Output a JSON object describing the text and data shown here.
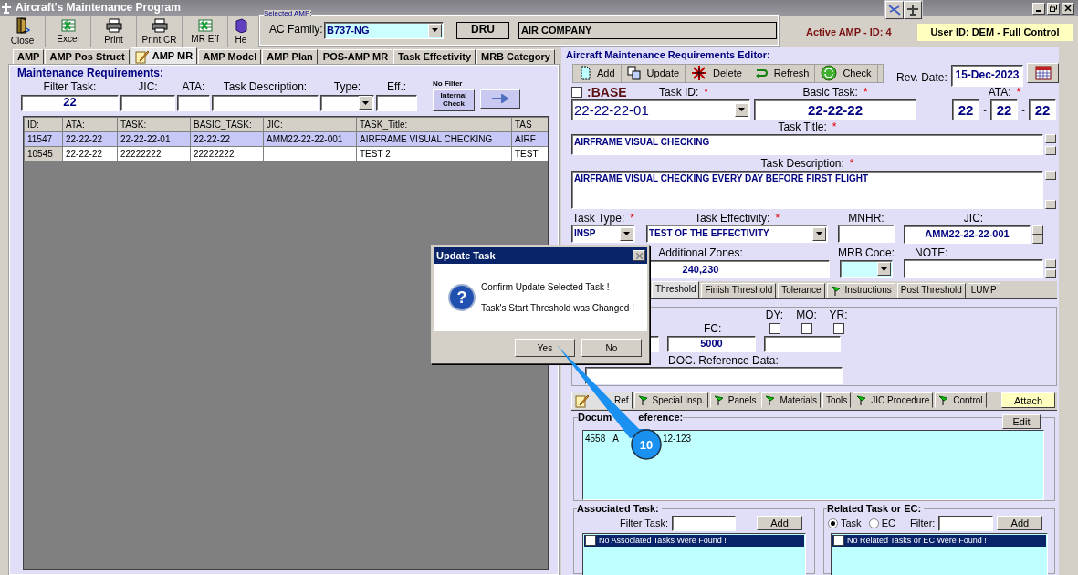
{
  "window": {
    "title": "Aircraft's Maintenance Program"
  },
  "toolbar": [
    {
      "label": "Close",
      "kind": "door"
    },
    {
      "label": "Excel",
      "kind": "sheet"
    },
    {
      "label": "Print",
      "kind": "printer"
    },
    {
      "label": "Print CR",
      "kind": "printer"
    },
    {
      "label": "MR Eff",
      "kind": "sheet"
    },
    {
      "label": "He",
      "kind": "help"
    }
  ],
  "selected_amp": {
    "legend": "Selected AMP:",
    "ac_family_label": "AC Family:",
    "ac_family": "B737-NG",
    "code": "DRU",
    "company": "AIR COMPANY"
  },
  "active_amp": "Active AMP - ID: 4",
  "user": "User ID: DEM - Full Control",
  "left_tabs": [
    {
      "label": "AMP",
      "selected": false,
      "kind": "plain"
    },
    {
      "label": "AMP Pos Struct",
      "selected": false,
      "kind": "plain"
    },
    {
      "label": "AMP MR",
      "selected": true,
      "kind": "note"
    },
    {
      "label": "AMP Model",
      "selected": false,
      "kind": "plain"
    },
    {
      "label": "AMP Plan",
      "selected": false,
      "kind": "plain"
    },
    {
      "label": "POS-AMP MR",
      "selected": false,
      "kind": "plain"
    },
    {
      "label": "Task Effectivity",
      "selected": false,
      "kind": "plain"
    },
    {
      "label": "MRB Category",
      "selected": false,
      "kind": "plain"
    }
  ],
  "requirements": {
    "legend": "Maintenance Requirements:",
    "filters": [
      {
        "label": "Filter Task:",
        "value": "22",
        "kind": "text"
      },
      {
        "label": "JIC:",
        "kind": "text"
      },
      {
        "label": "ATA:",
        "kind": "text"
      },
      {
        "label": "Task Description:",
        "kind": "text"
      },
      {
        "label": "Type:",
        "kind": "select"
      },
      {
        "label": "Eff.:",
        "kind": "text"
      }
    ],
    "no_filter": "No Filter",
    "internal_check": "Internal Check",
    "columns": [
      "ID:",
      "ATA:",
      "TASK:",
      "BASIC_TASK:",
      "JIC:",
      "TASK_Title:",
      "TAS"
    ],
    "rows": [
      {
        "selected": true,
        "cells": [
          "11547",
          "22-22-22",
          "22-22-22-01",
          "22-22-22",
          "AMM22-22-22-001",
          "AIRFRAME VISUAL CHECKING",
          "AIRF"
        ]
      },
      {
        "selected": false,
        "cells": [
          "10545",
          "22-22-22",
          "22222222",
          "22222222",
          null,
          "TEST 2",
          "TEST"
        ]
      }
    ]
  },
  "editor": {
    "legend": "Aircraft Maintenance Requirements Editor:",
    "toolbar": [
      {
        "label": "Add",
        "kind": "page"
      },
      {
        "label": "Update",
        "kind": "update"
      },
      {
        "label": "Delete",
        "kind": "delete"
      },
      {
        "label": "Refresh",
        "kind": "refresh"
      },
      {
        "label": "Check",
        "kind": "check"
      }
    ],
    "rev_date_label": "Rev. Date:",
    "rev_date": "15-Dec-2023",
    "base": {
      "label": ":BASE",
      "checked": false
    },
    "task_id": {
      "label": "Task ID:",
      "mark": "*",
      "value": "22-22-22-01"
    },
    "basic_task": {
      "label": "Basic Task:",
      "mark": "*",
      "value": "22-22-22"
    },
    "ata": {
      "label": "ATA:",
      "mark": "*",
      "parts": [
        "22",
        "22",
        "22"
      ],
      "separators": [
        "-",
        "-"
      ]
    },
    "task_title": {
      "label": "Task Title:",
      "mark": "*",
      "value": "AIRFRAME VISUAL CHECKING"
    },
    "task_description": {
      "label": "Task Description:",
      "mark": "*",
      "value": "AIRFRAME VISUAL CHECKING EVERY DAY BEFORE FIRST FLIGHT"
    },
    "task_type": {
      "label": "Task Type:",
      "mark": "*",
      "value": "INSP"
    },
    "task_effectivity": {
      "label": "Task Effectivity:",
      "mark": "*",
      "value": "TEST OF THE EFFECTIVITY"
    },
    "mnhr": {
      "label": "MNHR:"
    },
    "jic": {
      "label": "JIC:",
      "value": "AMM22-22-22-001"
    },
    "additional_zones": {
      "label": "Additional Zones:",
      "value": "240,230"
    },
    "mrb_code": {
      "label": "MRB Code:"
    },
    "note": {
      "label": "NOTE:"
    },
    "threshold_tabs": [
      {
        "label": "Threshold",
        "selected": true,
        "kind": "plain"
      },
      {
        "label": "Finish Threshold",
        "selected": false,
        "kind": "plain"
      },
      {
        "label": "Tolerance",
        "selected": false,
        "kind": "plain"
      },
      {
        "label": "Instructions",
        "selected": false,
        "kind": "flag"
      },
      {
        "label": "Post Threshold",
        "selected": false,
        "kind": "plain"
      },
      {
        "label": "LUMP",
        "selected": false,
        "kind": "plain"
      }
    ],
    "threshold": {
      "fc_label": "FC:",
      "fc": "5000",
      "periods": [
        {
          "label": "DY:",
          "checked": false
        },
        {
          "label": "MO:",
          "checked": false
        },
        {
          "label": "YR:",
          "checked": false
        }
      ],
      "doc_reference_label": "DOC. Reference Data:"
    },
    "doc_tabs": [
      {
        "label": "Ref",
        "selected": true,
        "kind": "note"
      },
      {
        "label": "Special Insp.",
        "selected": false,
        "kind": "flag"
      },
      {
        "label": "Panels",
        "selected": false,
        "kind": "flag"
      },
      {
        "label": "Materials",
        "selected": false,
        "kind": "flag"
      },
      {
        "label": "Tools",
        "selected": false,
        "kind": "plain"
      },
      {
        "label": "JIC Procedure",
        "selected": false,
        "kind": "flag"
      },
      {
        "label": "Control",
        "selected": false,
        "kind": "flag"
      }
    ],
    "attach": "Attach",
    "document_reference": {
      "legend": [
        "Docum",
        "eference:"
      ],
      "edit": "Edit",
      "text": [
        "4558",
        "A",
        "12-123"
      ]
    },
    "associated": {
      "legend": "Associated Task:",
      "filter_label": "Filter Task:",
      "add": "Add",
      "items": [
        {
          "label": "No Associated Tasks Were Found !",
          "checked": false
        }
      ]
    },
    "related": {
      "legend": "Related Task or EC:",
      "options": [
        {
          "label": "Task",
          "selected": true
        },
        {
          "label": "EC",
          "selected": false
        }
      ],
      "filter_label": "Filter:",
      "add": "Add",
      "items": [
        {
          "label": "No Related Tasks or EC Were Found !",
          "checked": false
        }
      ]
    }
  },
  "dialog": {
    "title": "Update Task",
    "icon": "?",
    "lines": [
      "Confirm Update Selected Task !",
      "Task's Start Threshold was Changed !"
    ],
    "buttons": [
      "Yes",
      "No"
    ]
  },
  "callout": {
    "number": "10"
  }
}
